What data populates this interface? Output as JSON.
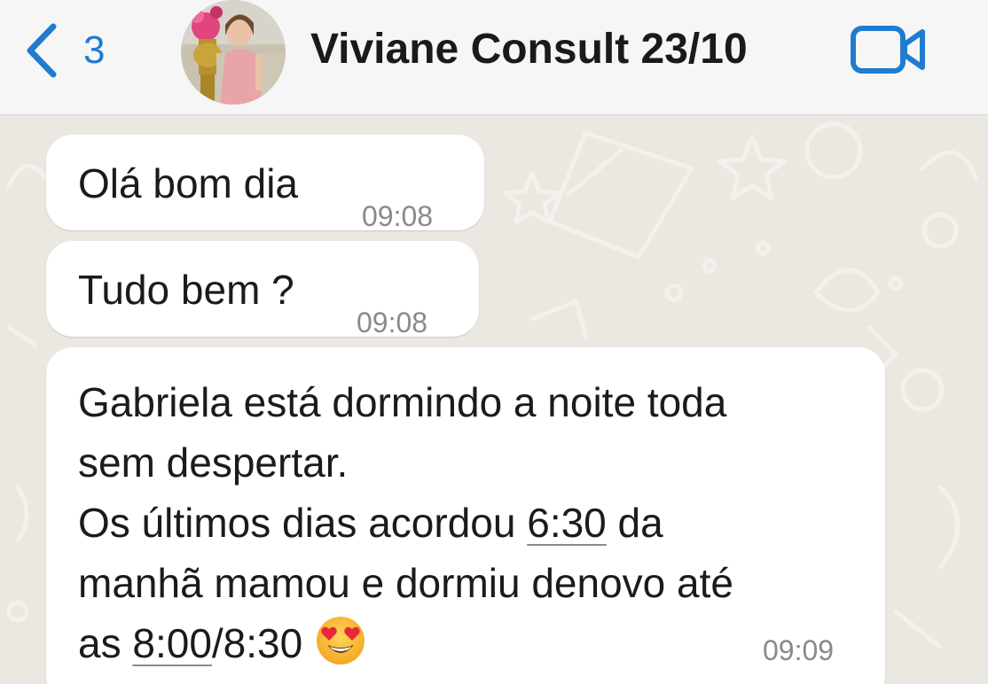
{
  "header": {
    "back_count": "3",
    "chat_title": "Viviane Consult 23/10",
    "icons": {
      "back": "chevron-left-icon",
      "video": "video-camera-icon"
    },
    "accent_color": "#1f7ccf"
  },
  "messages": [
    {
      "text": "Olá bom dia",
      "time": "09:08",
      "direction": "incoming"
    },
    {
      "text": "Tudo bem ?",
      "time": "09:08",
      "direction": "incoming"
    },
    {
      "lines": [
        "Gabriela está dormindo a noite toda",
        "sem despertar.",
        "Os últimos dias acordou ",
        "6:30",
        " da",
        "manhã mamou e dormiu denovo até",
        "as ",
        "8:00",
        "/8:30"
      ],
      "emoji": "heart-eyes-emoji",
      "time": "09:09",
      "direction": "incoming"
    }
  ],
  "colors": {
    "bubble": "#ffffff",
    "chat_background": "#ebe7e1",
    "header_background": "#f6f6f6",
    "timestamp": "#8a8a8a"
  }
}
